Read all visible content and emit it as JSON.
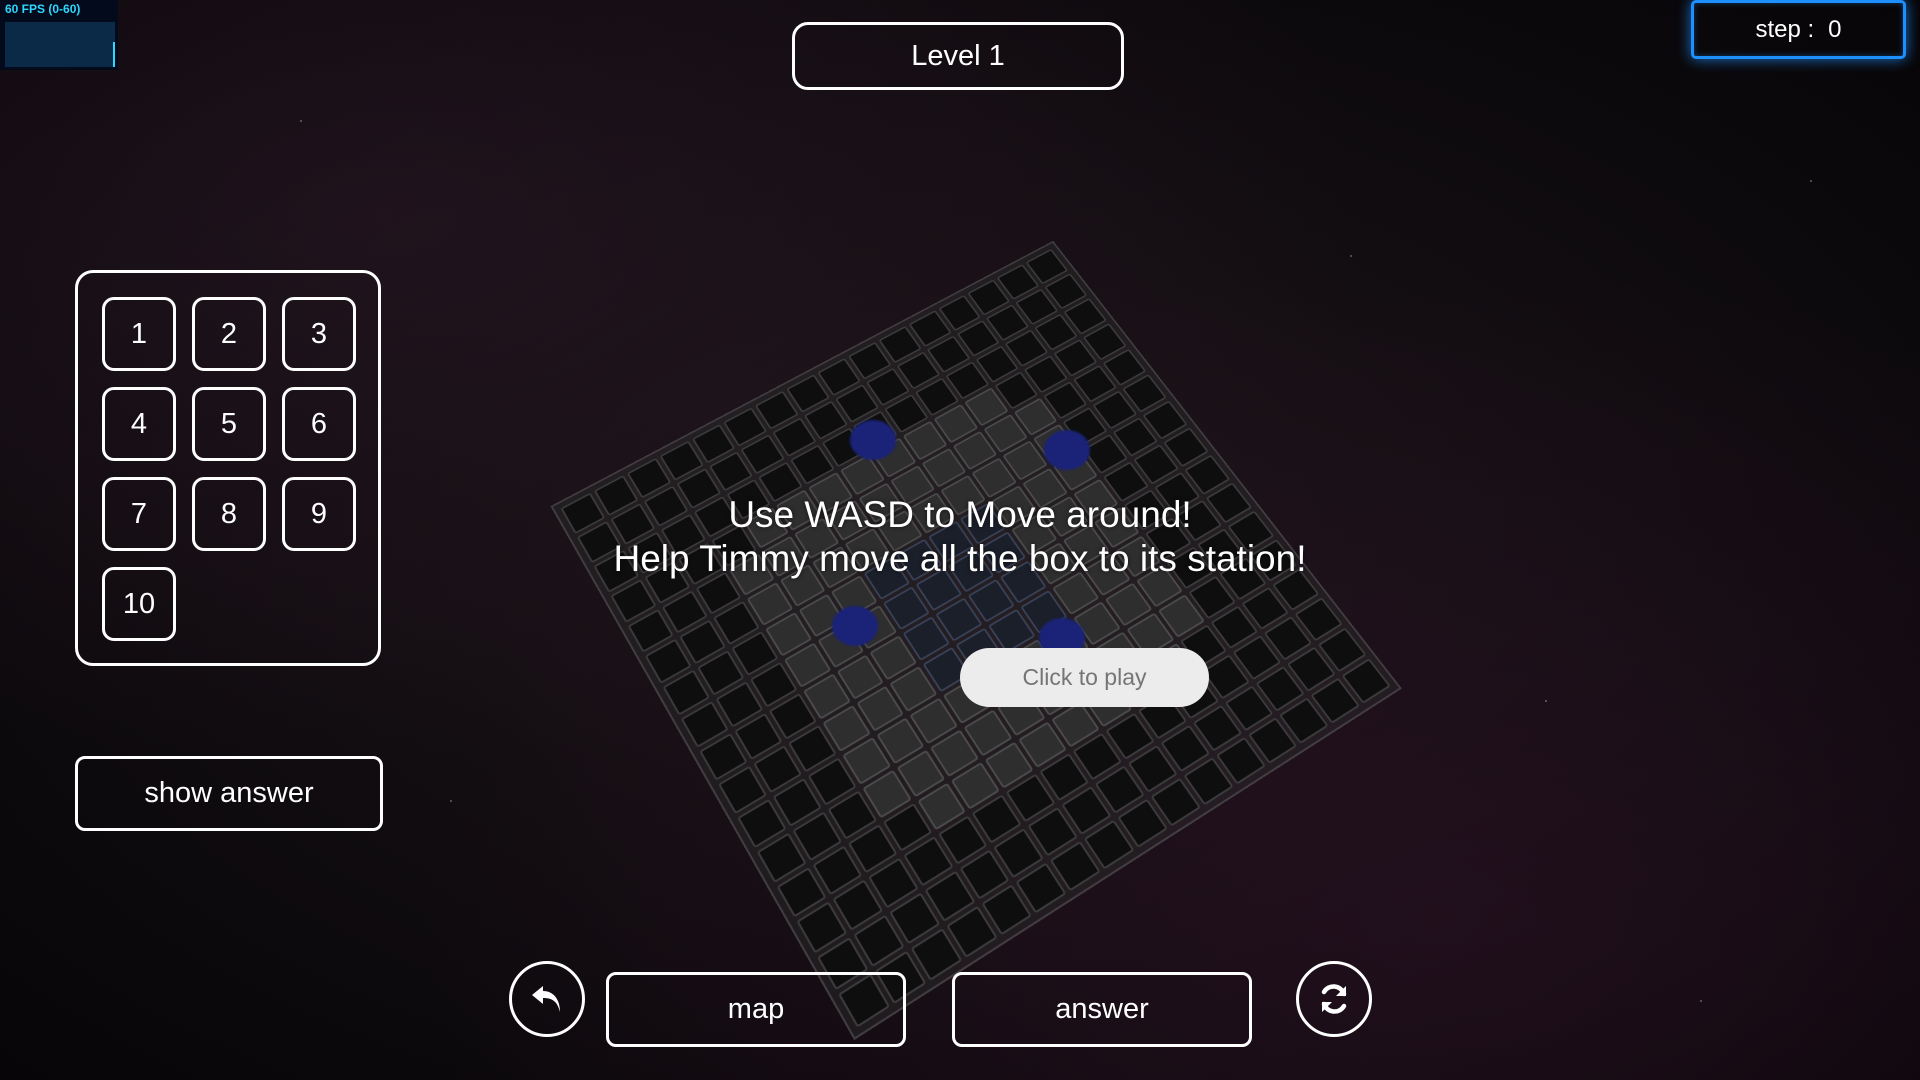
{
  "fps_meter": {
    "label": "60 FPS (0-60)",
    "fps": 60
  },
  "level": {
    "title": "Level 1"
  },
  "step": {
    "label": "step :",
    "value": "0"
  },
  "level_picker": {
    "levels": [
      "1",
      "2",
      "3",
      "4",
      "5",
      "6",
      "7",
      "8",
      "9",
      "10"
    ]
  },
  "buttons": {
    "show_answer": "show answer",
    "map": "map",
    "answer": "answer",
    "undo_icon": "undo-arrow-icon",
    "reset_icon": "refresh-icon"
  },
  "overlay": {
    "line1": "Use WASD to Move around!",
    "line2": "Help Timmy move all the box to its station!",
    "play": "Click to play"
  },
  "colors": {
    "step_border": "#1e8fff",
    "fps_text": "#2fd7ff",
    "goal": "#1a2378"
  }
}
